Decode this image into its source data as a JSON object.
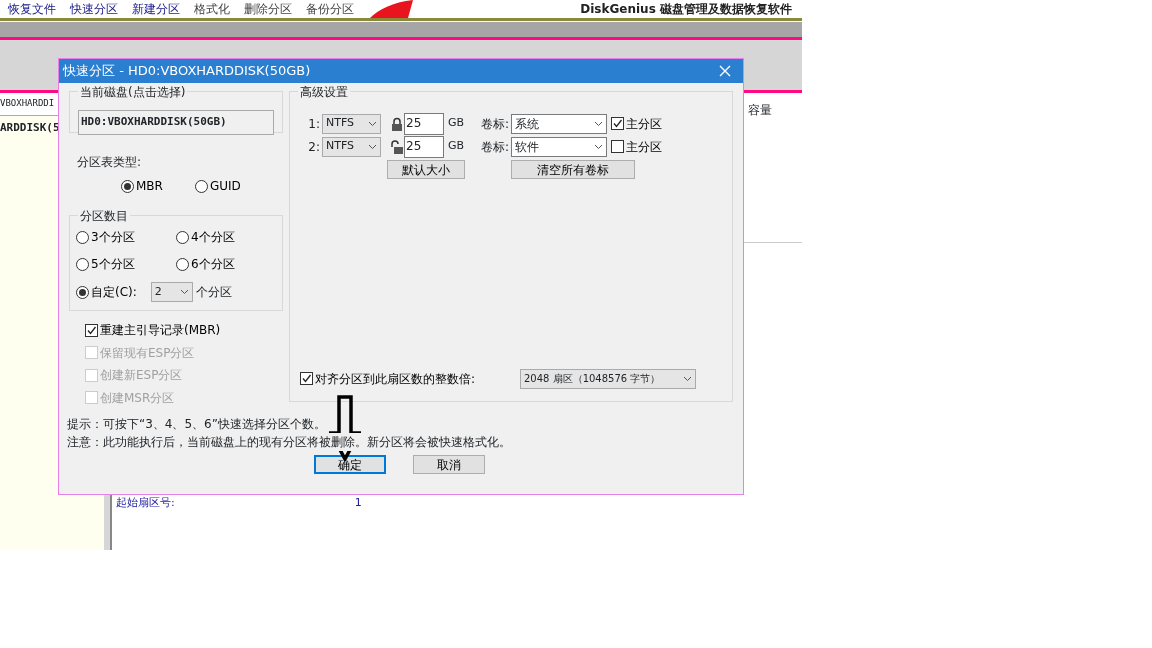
{
  "background": {
    "toolbar_items": [
      "恢复文件",
      "快速分区",
      "新建分区",
      "格式化",
      "删除分区",
      "备份分区"
    ],
    "app_title": "DiskGenius 磁盘管理及数据恢复软件",
    "disk_tab": "VBOXHARDDI",
    "disk_tree_item": "ARDDISK(5",
    "column_header": "容量",
    "field_label": "起始扇区号:",
    "field_value": "1"
  },
  "dialog": {
    "title": "快速分区 - HD0:VBOXHARDDISK(50GB)",
    "current_disk": {
      "legend": "当前磁盘(点击选择)",
      "value": "HD0:VBOXHARDDISK(50GB)"
    },
    "table_type": {
      "label": "分区表类型:",
      "options": [
        {
          "label": "MBR",
          "selected": true
        },
        {
          "label": "GUID",
          "selected": false
        }
      ]
    },
    "partition_count": {
      "legend": "分区数目",
      "options": [
        {
          "label": "3个分区",
          "selected": false
        },
        {
          "label": "4个分区",
          "selected": false
        },
        {
          "label": "5个分区",
          "selected": false
        },
        {
          "label": "6个分区",
          "selected": false
        },
        {
          "label": "自定(C):",
          "selected": true
        }
      ],
      "custom_value": "2",
      "custom_suffix": "个分区"
    },
    "checkboxes": [
      {
        "label": "重建主引导记录(MBR)",
        "checked": true,
        "disabled": false
      },
      {
        "label": "保留现有ESP分区",
        "checked": false,
        "disabled": true
      },
      {
        "label": "创建新ESP分区",
        "checked": false,
        "disabled": true
      },
      {
        "label": "创建MSR分区",
        "checked": false,
        "disabled": true
      }
    ],
    "advanced": {
      "legend": "高级设置",
      "partitions": [
        {
          "index": "1:",
          "fs": "NTFS",
          "locked": true,
          "size": "25",
          "unit": "GB",
          "label_caption": "卷标:",
          "volume_label": "系统",
          "primary_label": "主分区",
          "primary": true
        },
        {
          "index": "2:",
          "fs": "NTFS",
          "locked": false,
          "size": "25",
          "unit": "GB",
          "label_caption": "卷标:",
          "volume_label": "软件",
          "primary_label": "主分区",
          "primary": false
        }
      ],
      "buttons": [
        "默认大小",
        "清空所有卷标"
      ],
      "align": {
        "label": "对齐分区到此扇区数的整数倍:",
        "checked": true,
        "value": "2048 扇区（1048576 字节）"
      }
    },
    "hints": [
      "提示：可按下“3、4、5、6”快速选择分区个数。",
      "注意：此功能执行后，当前磁盘上的现有分区将被删除。新分区将会被快速格式化。"
    ],
    "buttons": [
      {
        "label": "确定",
        "default": true
      },
      {
        "label": "取消",
        "default": false
      }
    ]
  }
}
